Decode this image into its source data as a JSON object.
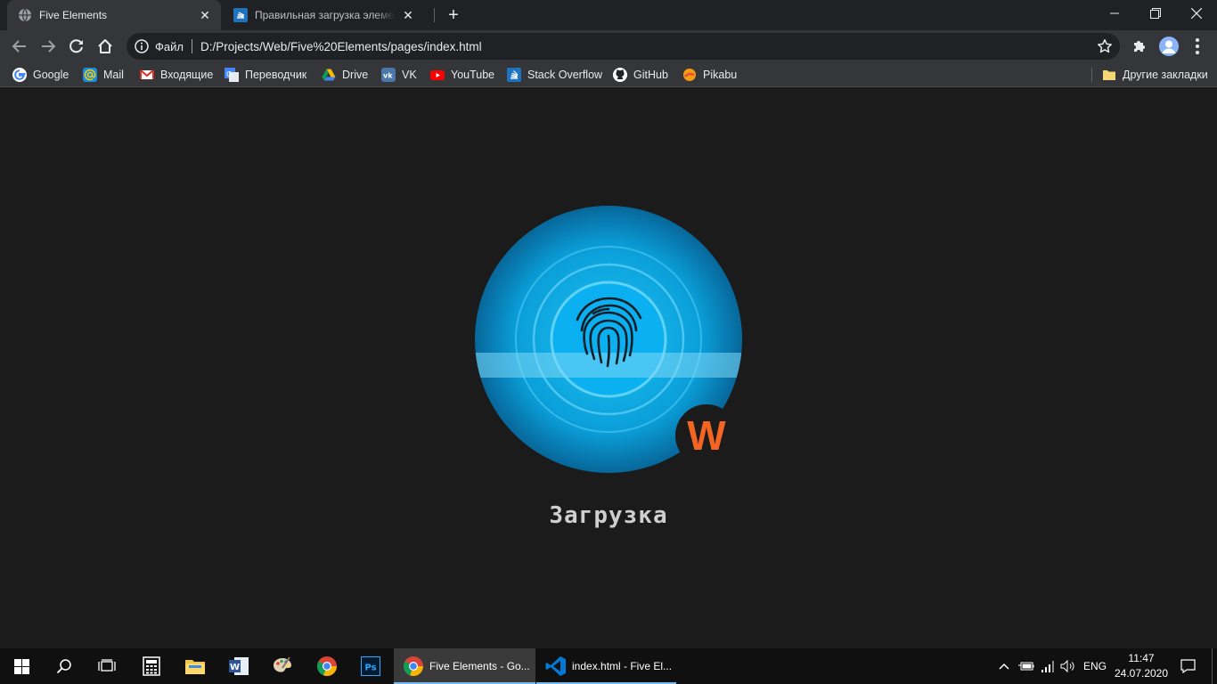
{
  "browser": {
    "tabs": [
      {
        "title": "Five Elements",
        "active": true
      },
      {
        "title": "Правильная загрузка элементов",
        "active": false
      }
    ],
    "address": {
      "scheme": "Файл",
      "url": "D:/Projects/Web/Five%20Elements/pages/index.html"
    },
    "bookmarks": [
      "Google",
      "Mail",
      "Входящие",
      "Переводчик",
      "Drive",
      "VK",
      "YouTube",
      "Stack Overflow",
      "GitHub",
      "Pikabu"
    ],
    "other_bookmarks": "Другие закладки"
  },
  "page": {
    "loading_text": "Загрузка",
    "badge_letter": "W",
    "colors": {
      "accent": "#0aa7e6",
      "badge": "#f26522",
      "background": "#1b1b1b"
    }
  },
  "taskbar": {
    "apps": [
      {
        "title": "Five Elements - Go...",
        "active": true
      },
      {
        "title": "index.html - Five El...",
        "active": false
      }
    ],
    "language": "ENG",
    "time": "11:47",
    "date": "24.07.2020"
  }
}
